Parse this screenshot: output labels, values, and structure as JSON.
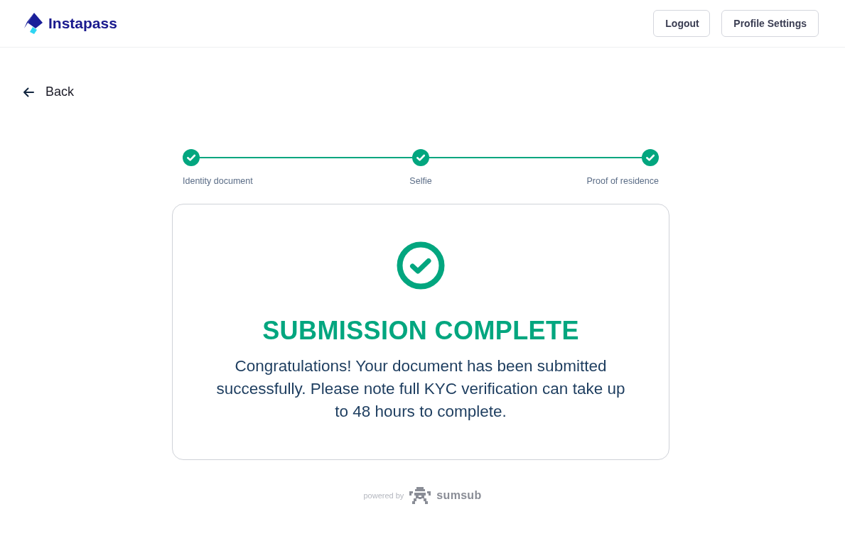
{
  "header": {
    "logo_text": "Instapass",
    "buttons": [
      "Logout",
      "Profile Settings"
    ]
  },
  "back_link": "Back",
  "steps": [
    {
      "label": "Identity document",
      "completed": true
    },
    {
      "label": "Selfie",
      "completed": true
    },
    {
      "label": "Proof of residence",
      "completed": true
    }
  ],
  "result_card": {
    "title": "SUBMISSION COMPLETE",
    "message": "Congratulations! Your document has been submitted successfully. Please note full KYC verification can take up to 48 hours to complete."
  },
  "footer": {
    "powered_by": "powered by",
    "brand": "sumsub"
  }
}
